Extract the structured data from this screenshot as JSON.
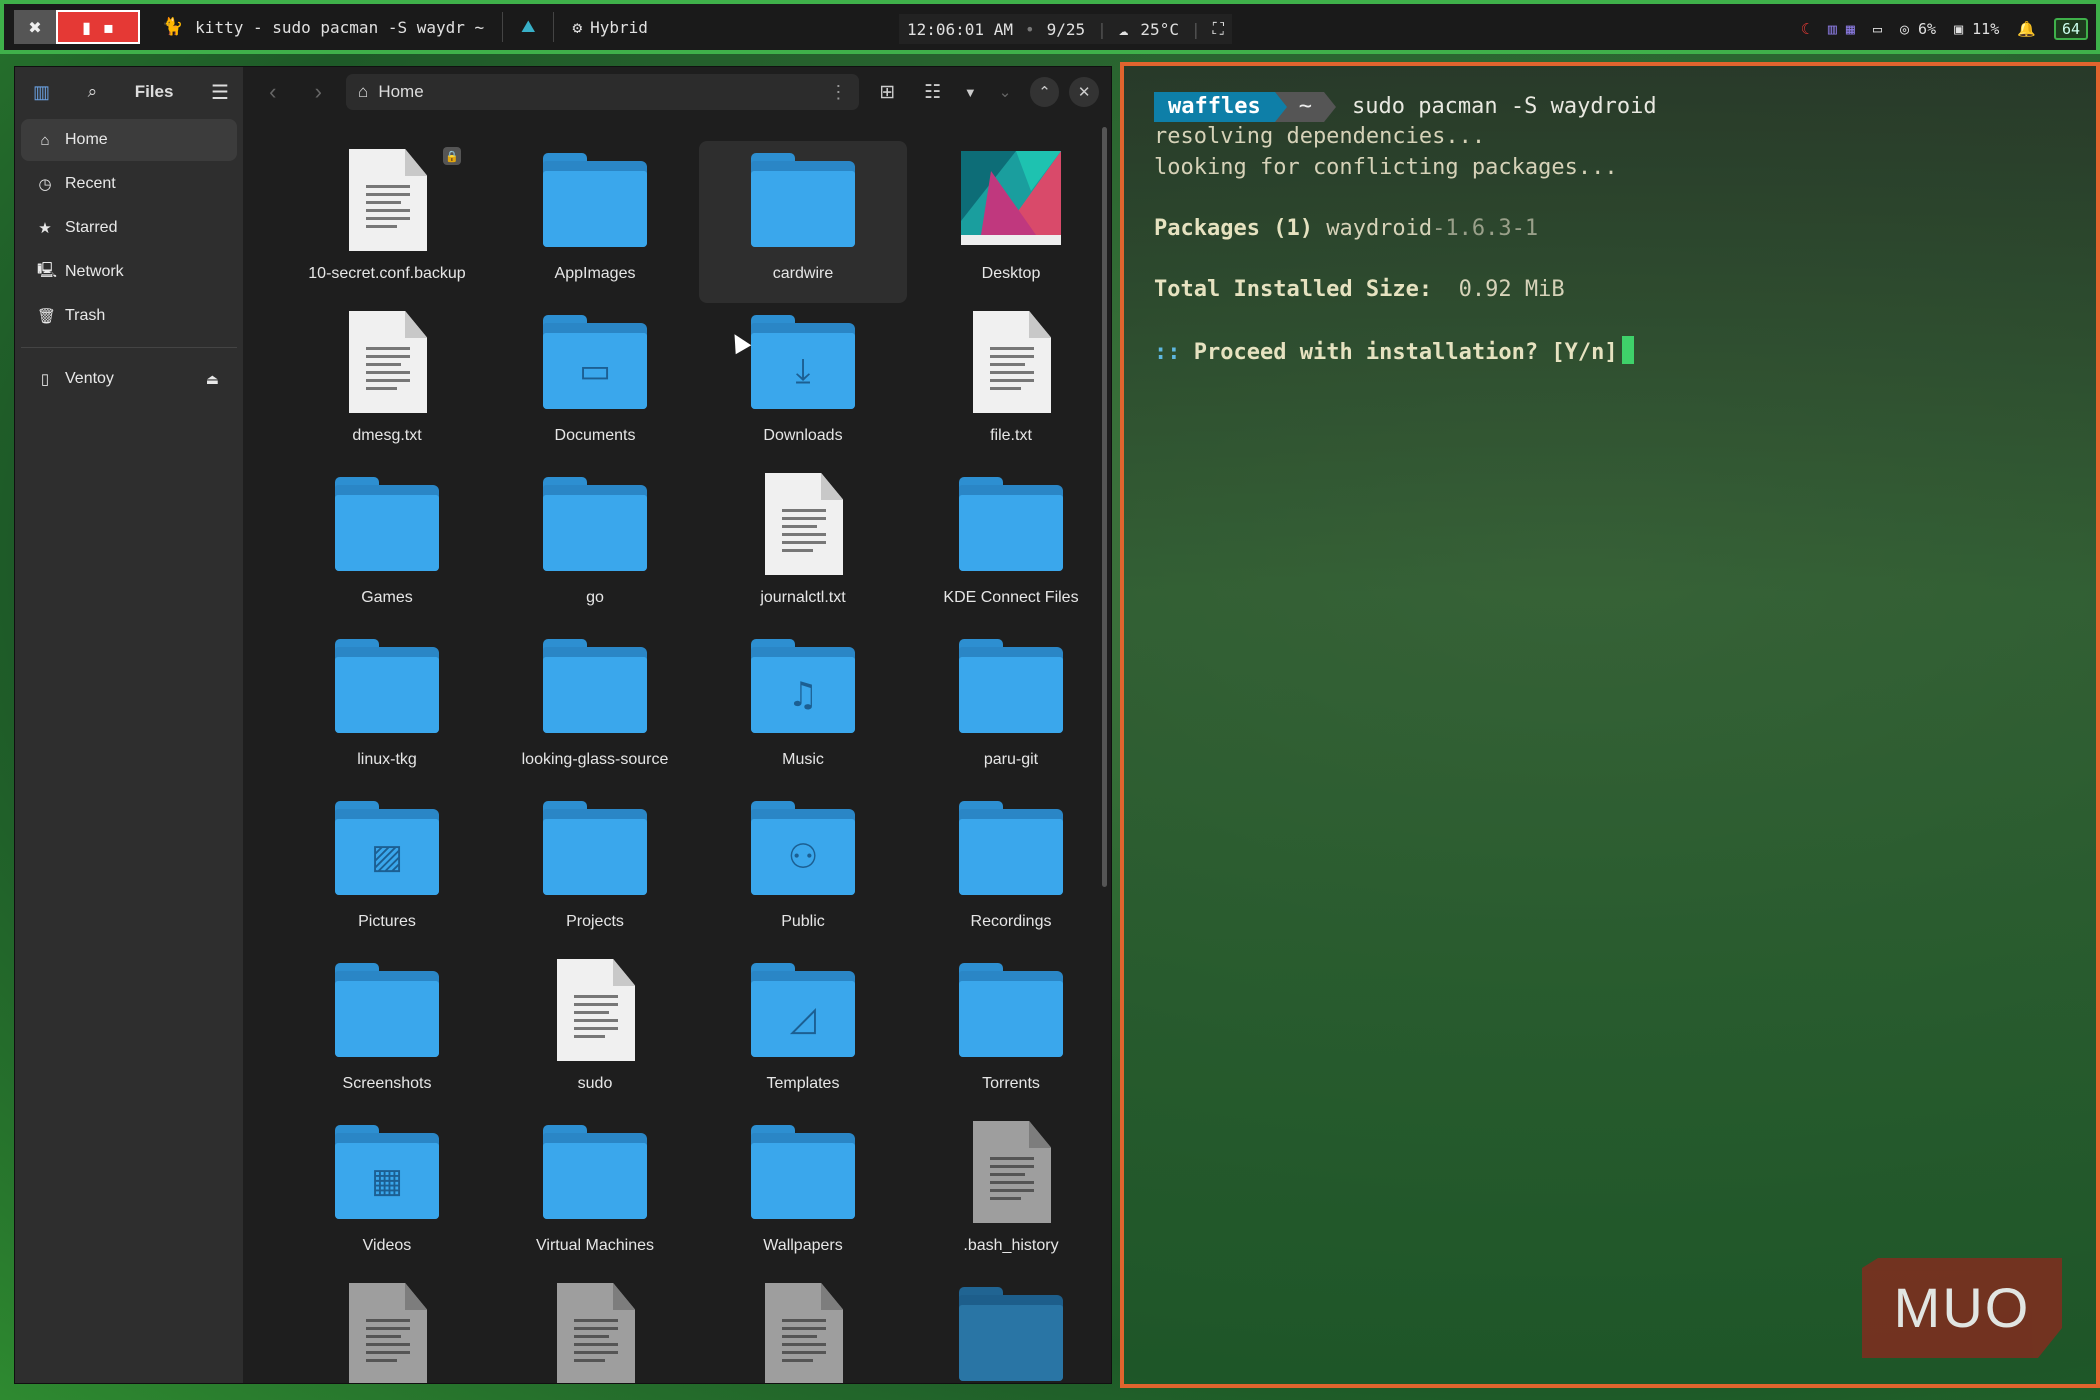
{
  "topbar": {
    "window_title": "kitty - sudo pacman -S waydr ~",
    "app_name": "kitty",
    "power_mode": "Hybrid",
    "clock": "12:06:01 AM",
    "date": "9/25",
    "weather": "25°C",
    "cpu": "6%",
    "memory": "11%",
    "battery": "64"
  },
  "filemanager": {
    "title": "Files",
    "path": "Home",
    "sidebar": [
      {
        "label": "Home",
        "icon": "home-icon",
        "active": true
      },
      {
        "label": "Recent",
        "icon": "clock-icon"
      },
      {
        "label": "Starred",
        "icon": "star-icon"
      },
      {
        "label": "Network",
        "icon": "network-icon"
      },
      {
        "label": "Trash",
        "icon": "trash-icon"
      }
    ],
    "devices": [
      {
        "label": "Ventoy",
        "icon": "usb-icon"
      }
    ],
    "items": [
      {
        "name": "10-secret.conf.backup",
        "type": "doc",
        "locked": true
      },
      {
        "name": "AppImages",
        "type": "folder"
      },
      {
        "name": "cardwire",
        "type": "folder",
        "hover": true
      },
      {
        "name": "Desktop",
        "type": "desktop"
      },
      {
        "name": "dmesg.txt",
        "type": "doc"
      },
      {
        "name": "Documents",
        "type": "folder",
        "emblem": "document"
      },
      {
        "name": "Downloads",
        "type": "folder",
        "emblem": "download"
      },
      {
        "name": "file.txt",
        "type": "doc"
      },
      {
        "name": "Games",
        "type": "folder"
      },
      {
        "name": "go",
        "type": "folder"
      },
      {
        "name": "journalctl.txt",
        "type": "doc"
      },
      {
        "name": "KDE Connect Files",
        "type": "folder"
      },
      {
        "name": "linux-tkg",
        "type": "folder"
      },
      {
        "name": "looking-glass-source",
        "type": "folder"
      },
      {
        "name": "Music",
        "type": "folder",
        "emblem": "music"
      },
      {
        "name": "paru-git",
        "type": "folder"
      },
      {
        "name": "Pictures",
        "type": "folder",
        "emblem": "picture"
      },
      {
        "name": "Projects",
        "type": "folder"
      },
      {
        "name": "Public",
        "type": "folder",
        "emblem": "people"
      },
      {
        "name": "Recordings",
        "type": "folder"
      },
      {
        "name": "Screenshots",
        "type": "folder"
      },
      {
        "name": "sudo",
        "type": "doc"
      },
      {
        "name": "Templates",
        "type": "folder",
        "emblem": "template"
      },
      {
        "name": "Torrents",
        "type": "folder"
      },
      {
        "name": "Videos",
        "type": "folder",
        "emblem": "video"
      },
      {
        "name": "Virtual Machines",
        "type": "folder"
      },
      {
        "name": "Wallpapers",
        "type": "folder"
      },
      {
        "name": ".bash_history",
        "type": "doc-grey"
      },
      {
        "name": "",
        "type": "doc-grey"
      },
      {
        "name": "",
        "type": "doc-grey"
      },
      {
        "name": "",
        "type": "doc-grey"
      },
      {
        "name": "",
        "type": "folder-dark"
      }
    ]
  },
  "terminal": {
    "user": "waffles",
    "dir": "~",
    "command": "sudo pacman -S waydroid",
    "line1": "resolving dependencies...",
    "line2": "looking for conflicting packages...",
    "packages_label": "Packages (1)",
    "package_name": "waydroid",
    "package_version": "-1.6.3-1",
    "size_label": "Total Installed Size:",
    "size_value": "0.92 MiB",
    "prompt_prefix": "::",
    "prompt_text": "Proceed with installation? [Y/n]"
  },
  "watermark": "MUO",
  "colors": {
    "accent_green": "#3fb04a",
    "terminal_border": "#e0642e",
    "folder_blue": "#3aa7ec",
    "prompt_user_bg": "#0e7fa8",
    "cursor_green": "#3fd16a"
  }
}
